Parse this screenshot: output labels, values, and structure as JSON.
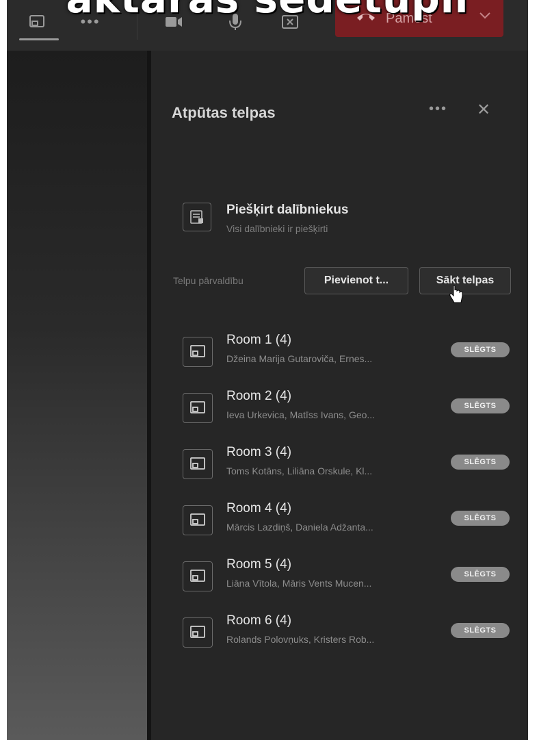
{
  "caption": "aktarās sēdētupli",
  "toolbar": {
    "leave_label": "Pamest"
  },
  "panel": {
    "title": "Atpūtas telpas",
    "assign": {
      "title": "Piešķirt dalībniekus",
      "subtitle": "Visi dalībnieki ir piešķirti"
    },
    "manage_label": "Telpu pārvaldību",
    "add_button": "Pievienot t...",
    "start_button": "Sākt telpas"
  },
  "rooms": [
    {
      "name": "Room 1 (4)",
      "members": "Džeina Marija Gutaroviča, Ernes...",
      "status": "SLĒGTS"
    },
    {
      "name": "Room 2 (4)",
      "members": "Ieva Urkevica, Matīss Ivans, Geo...",
      "status": "SLĒGTS"
    },
    {
      "name": "Room 3 (4)",
      "members": "Toms Kotāns, Liliāna Orskule, Kl...",
      "status": "SLĒGTS"
    },
    {
      "name": "Room 4 (4)",
      "members": "Mārcis Lazdiņš, Daniela Adžanta...",
      "status": "SLĒGTS"
    },
    {
      "name": "Room 5 (4)",
      "members": "Liāna Vītola, Māris Vents Mucen...",
      "status": "SLĒGTS"
    },
    {
      "name": "Room 6 (4)",
      "members": "Rolands Polovņuks, Kristers Rob...",
      "status": "SLĒGTS"
    }
  ],
  "colors": {
    "background": "#1f1f1f",
    "panel": "#262626",
    "leave_button": "#7a1e22",
    "badge": "#8a8a8a"
  },
  "icons": [
    "share-screen-icon",
    "more-icon",
    "camera-icon",
    "microphone-icon",
    "share-tray-icon",
    "phone-hangup-icon",
    "chevron-down-icon",
    "close-icon",
    "assign-participants-icon",
    "room-icon",
    "hand-cursor-icon"
  ]
}
